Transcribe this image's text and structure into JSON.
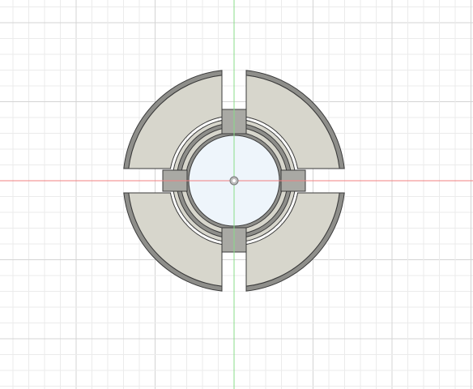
{
  "viewport": {
    "background": "#ffffff",
    "grid_minor_color": "#ebebeb",
    "grid_major_color": "#d4d4d4"
  },
  "axes": {
    "x_axis_color": "#f08080",
    "y_axis_color": "#88dd88"
  },
  "model": {
    "face_fill": "#d7d6cc",
    "edge_color": "#3a3a3a",
    "rim_fill": "#8e8e8a",
    "bore_fill": "#eef5fb",
    "gap_fill": "#eef5fb",
    "tab_fill": "#a9a9a4",
    "origin_marker_fill": "#bdbdbd"
  }
}
